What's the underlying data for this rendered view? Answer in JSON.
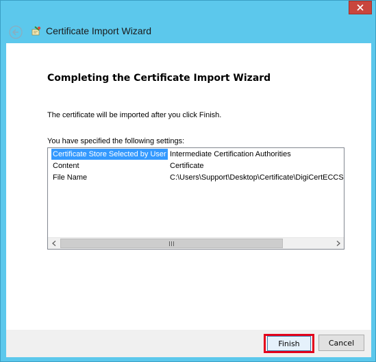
{
  "window": {
    "title": "Certificate Import Wizard",
    "close_icon": "close-icon",
    "back_icon": "back-arrow-icon",
    "app_icon": "certificate-icon",
    "frame_color": "#5cc8ec",
    "close_color": "#c9463d"
  },
  "page": {
    "heading": "Completing the Certificate Import Wizard",
    "info": "The certificate will be imported after you click Finish.",
    "settings_label": "You have specified the following settings:"
  },
  "settings": [
    {
      "key": "Certificate Store Selected by User",
      "value": "Intermediate Certification Authorities",
      "selected": true
    },
    {
      "key": "Content",
      "value": "Certificate",
      "selected": false
    },
    {
      "key": "File Name",
      "value": "C:\\Users\\Support\\Desktop\\Certificate\\DigiCertECCSe",
      "selected": false
    }
  ],
  "buttons": {
    "finish": "Finish",
    "cancel": "Cancel",
    "highlight_color": "#e3001b"
  }
}
